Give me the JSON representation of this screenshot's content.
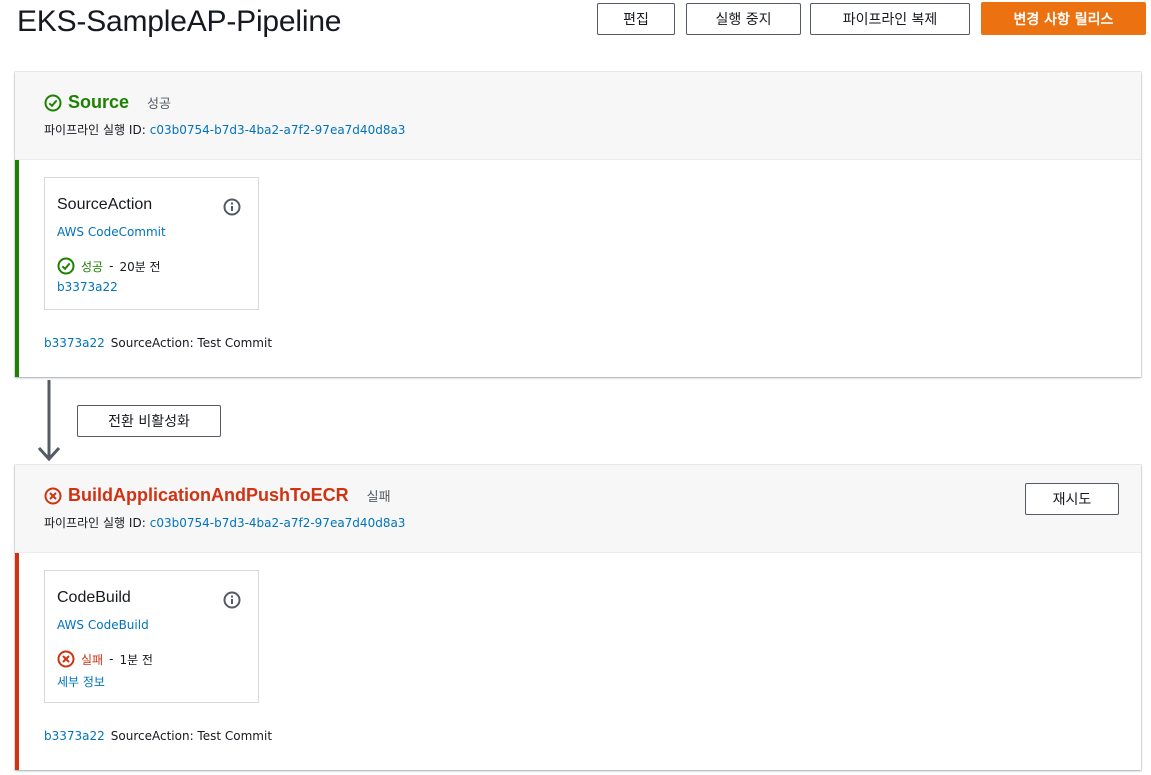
{
  "header": {
    "title": "EKS-SampleAP-Pipeline",
    "buttons": {
      "edit": "편집",
      "stop": "실행 중지",
      "clone": "파이프라인 복제",
      "release": "변경 사항 릴리스"
    }
  },
  "colors": {
    "success": "#1d8102",
    "failed": "#d13212",
    "link": "#0073bb",
    "primary": "#ec7211"
  },
  "stages": [
    {
      "name": "Source",
      "status": "성공",
      "status_icon": "check-circle-icon",
      "exec_label": "파이프라인 실행 ID:",
      "exec_id": "c03b0754-b7d3-4ba2-a7f2-97ea7d40d8a3",
      "action": {
        "name": "SourceAction",
        "provider": "AWS CodeCommit",
        "status": "성공",
        "time": "20분 전",
        "link": "b3373a22"
      },
      "commit_id": "b3373a22",
      "commit_msg": "SourceAction: Test Commit"
    },
    {
      "name": "BuildApplicationAndPushToECR",
      "status": "실패",
      "status_icon": "x-circle-icon",
      "exec_label": "파이프라인 실행 ID:",
      "exec_id": "c03b0754-b7d3-4ba2-a7f2-97ea7d40d8a3",
      "retry": "재시도",
      "action": {
        "name": "CodeBuild",
        "provider": "AWS CodeBuild",
        "status": "실패",
        "time": "1분 전",
        "link": "세부 정보"
      },
      "commit_id": "b3373a22",
      "commit_msg": "SourceAction: Test Commit"
    }
  ],
  "transition": {
    "label": "전환 비활성화"
  }
}
